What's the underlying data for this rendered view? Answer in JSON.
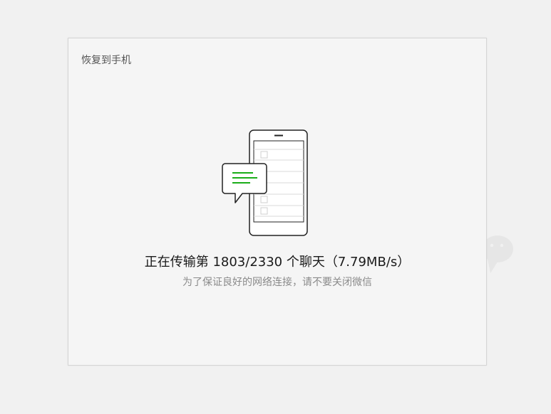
{
  "dialog": {
    "title": "恢复到手机"
  },
  "status": {
    "message": "正在传输第 1803/2330 个聊天（7.79MB/s）",
    "hint": "为了保证良好的网络连接，请不要关闭微信"
  },
  "icons": {
    "illustration": "phone-with-chat-bubble-icon",
    "background": "wechat-logo-icon"
  },
  "colors": {
    "accent": "#1aad19",
    "background": "#f1f1f1",
    "dialog": "#f5f5f5"
  }
}
